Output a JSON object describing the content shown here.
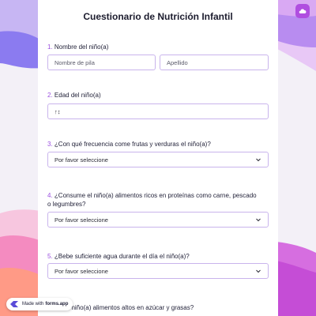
{
  "form": {
    "title": "Cuestionario de Nutrición Infantil"
  },
  "questions": [
    {
      "num": "1.",
      "text": "Nombre del niño(a)"
    },
    {
      "num": "2.",
      "text": "Edad del niño(a)"
    },
    {
      "num": "3.",
      "text": "¿Con qué frecuencia come frutas y verduras el niño(a)?"
    },
    {
      "num": "4.",
      "text": "¿Consume el niño(a) alimentos ricos en proteínas como carne, pescado o legumbres?"
    },
    {
      "num": "5.",
      "text": "¿Bebe suficiente agua durante el día el niño(a)?"
    },
    {
      "num": "6.",
      "text": "...me el niño(a) alimentos altos en azúcar y grasas?"
    }
  ],
  "fields": {
    "first_name_placeholder": "Nombre de pila",
    "last_name_placeholder": "Apellido",
    "age_value": "↑↕",
    "select_placeholder": "Por favor seleccione"
  },
  "badge": {
    "prefix": "Made with",
    "brand": "forms.app"
  },
  "colors": {
    "accent": "#9b4fe0",
    "field_border": "#c9b4ec",
    "top_button": "#b04ee0"
  },
  "icons": {
    "top_button": "cloud-icon",
    "select_arrow": "chevron-down-icon",
    "brand_logo": "forms-app-logo-icon"
  }
}
